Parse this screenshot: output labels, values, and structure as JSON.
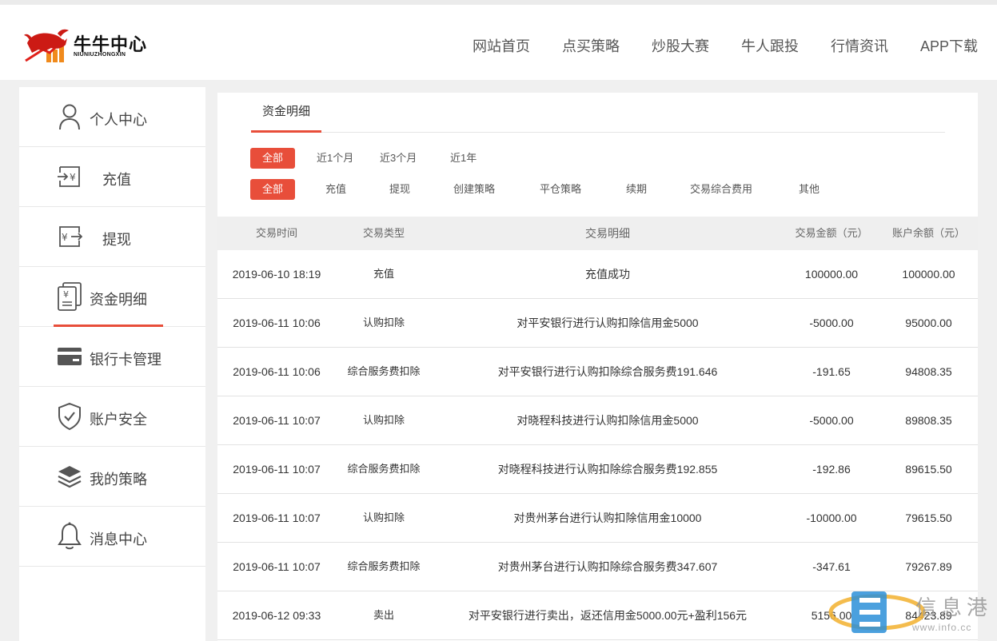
{
  "brand": {
    "name_cn": "牛牛中心",
    "name_en": "NIUNIUZHONGXIN"
  },
  "nav": [
    "网站首页",
    "点买策略",
    "炒股大赛",
    "牛人跟投",
    "行情资讯",
    "APP下载"
  ],
  "sidebar": {
    "items": [
      {
        "label": "个人中心",
        "icon": "user-icon"
      },
      {
        "label": "充值",
        "icon": "recharge-icon"
      },
      {
        "label": "提现",
        "icon": "withdraw-icon"
      },
      {
        "label": "资金明细",
        "icon": "fund-detail-icon"
      },
      {
        "label": "银行卡管理",
        "icon": "bank-card-icon"
      },
      {
        "label": "账户安全",
        "icon": "shield-icon"
      },
      {
        "label": "我的策略",
        "icon": "layers-icon"
      },
      {
        "label": "消息中心",
        "icon": "bell-icon"
      }
    ]
  },
  "main": {
    "tab": "资金明细",
    "time_filters": [
      "全部",
      "近1个月",
      "近3个月",
      "近1年"
    ],
    "type_filters": [
      "全部",
      "充值",
      "提现",
      "创建策略",
      "平仓策略",
      "续期",
      "交易综合费用",
      "其他"
    ],
    "columns": [
      "交易时间",
      "交易类型",
      "交易明细",
      "交易金额（元）",
      "账户余额（元）"
    ],
    "rows": [
      [
        "2019-06-10 18:19",
        "充值",
        "充值成功",
        "100000.00",
        "100000.00"
      ],
      [
        "2019-06-11 10:06",
        "认购扣除",
        "对平安银行进行认购扣除信用金5000",
        "-5000.00",
        "95000.00"
      ],
      [
        "2019-06-11 10:06",
        "综合服务费扣除",
        "对平安银行进行认购扣除综合服务费191.646",
        "-191.65",
        "94808.35"
      ],
      [
        "2019-06-11 10:07",
        "认购扣除",
        "对晓程科技进行认购扣除信用金5000",
        "-5000.00",
        "89808.35"
      ],
      [
        "2019-06-11 10:07",
        "综合服务费扣除",
        "对晓程科技进行认购扣除综合服务费192.855",
        "-192.86",
        "89615.50"
      ],
      [
        "2019-06-11 10:07",
        "认购扣除",
        "对贵州茅台进行认购扣除信用金10000",
        "-10000.00",
        "79615.50"
      ],
      [
        "2019-06-11 10:07",
        "综合服务费扣除",
        "对贵州茅台进行认购扣除综合服务费347.607",
        "-347.61",
        "79267.89"
      ],
      [
        "2019-06-12 09:33",
        "卖出",
        "对平安银行进行卖出，返还信用金5000.00元+盈利156元",
        "5156.00",
        "84423.89"
      ]
    ]
  },
  "watermark": {
    "text": "信息港",
    "url": "www.info.cc"
  },
  "colors": {
    "accent": "#e84e3a",
    "header_bg": "#ffffff",
    "page_bg": "#f0f0f0"
  }
}
